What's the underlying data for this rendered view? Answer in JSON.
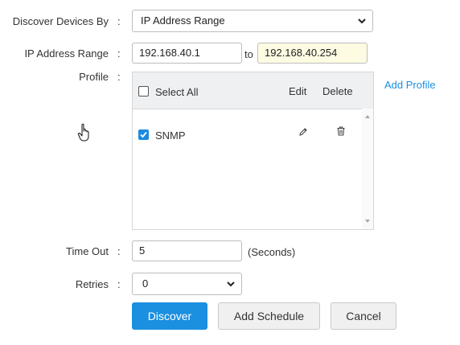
{
  "discover_by": {
    "label": "Discover Devices By",
    "colon": ":",
    "selected": "IP Address Range"
  },
  "ip_range": {
    "label": "IP Address Range",
    "colon": ":",
    "start": "192.168.40.1",
    "to": "to",
    "end": "192.168.40.254"
  },
  "profile": {
    "label": "Profile",
    "colon": ":",
    "add_profile": "Add Profile",
    "header": {
      "select_all": "Select All",
      "edit": "Edit",
      "delete": "Delete"
    },
    "rows": [
      {
        "name": "SNMP",
        "checked": true
      }
    ]
  },
  "timeout": {
    "label": "Time Out",
    "colon": ":",
    "value": "5",
    "unit": "(Seconds)"
  },
  "retries": {
    "label": "Retries",
    "colon": ":",
    "selected": "0"
  },
  "buttons": {
    "discover": "Discover",
    "add_schedule": "Add Schedule",
    "cancel": "Cancel"
  },
  "icons": {
    "edit": "pencil-icon",
    "delete": "trash-icon",
    "cursor": "hand-pointer-icon"
  },
  "colors": {
    "accent": "#1b8fe0",
    "highlight_input": "#fefbe3"
  }
}
